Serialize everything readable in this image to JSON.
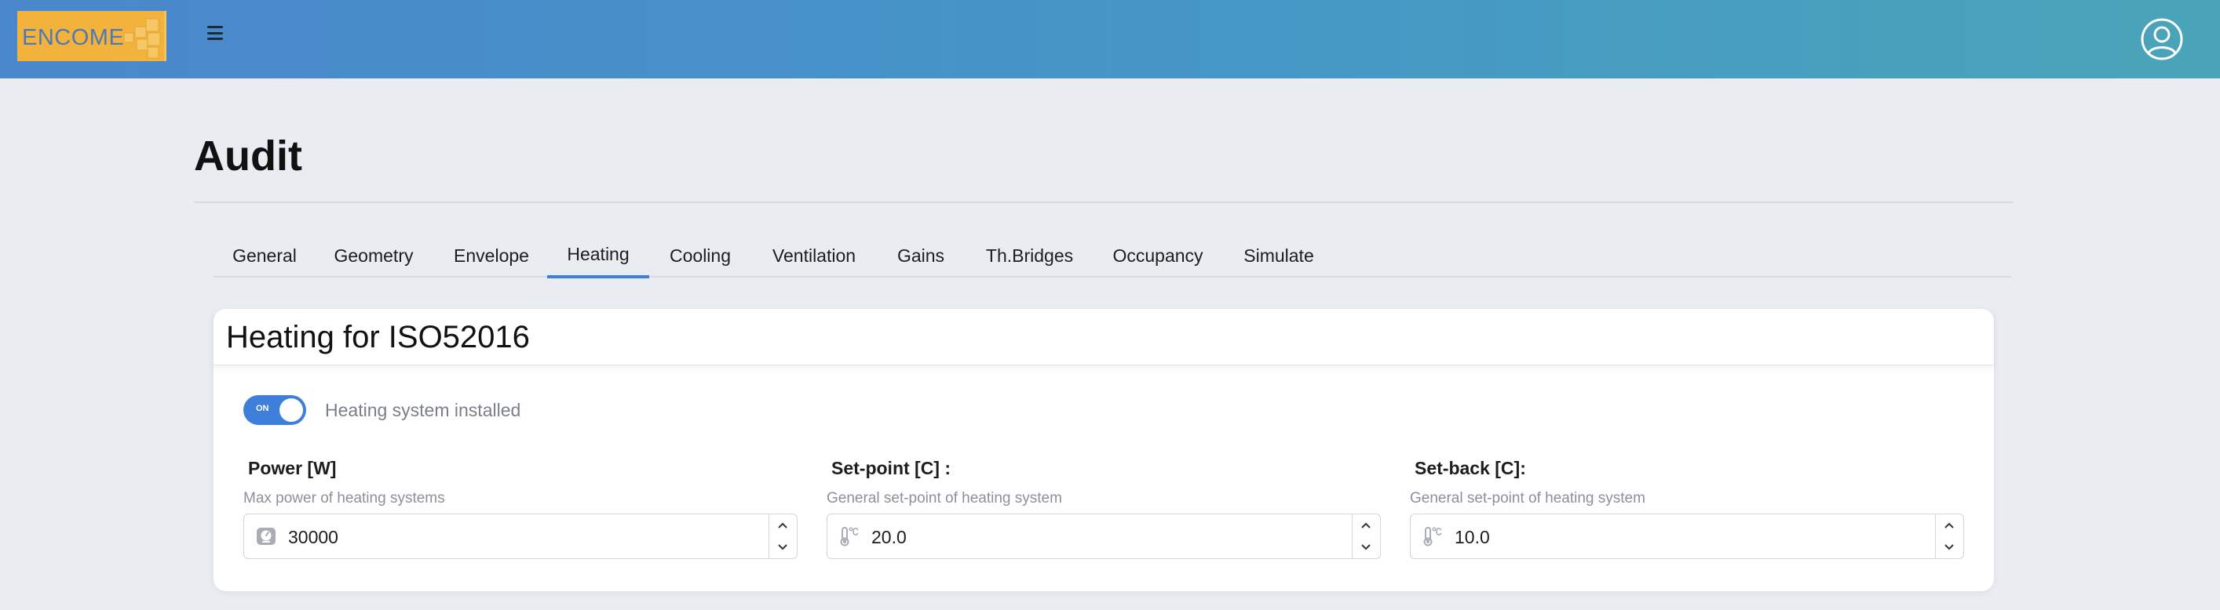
{
  "header": {
    "logo_text": "ENCOME",
    "menu_icon": "hamburger-icon",
    "user_icon": "user-circle-icon"
  },
  "page": {
    "title": "Audit"
  },
  "tabs": [
    {
      "label": "General"
    },
    {
      "label": "Geometry"
    },
    {
      "label": "Envelope"
    },
    {
      "label": "Heating",
      "active": true
    },
    {
      "label": "Cooling"
    },
    {
      "label": "Ventilation"
    },
    {
      "label": "Gains"
    },
    {
      "label": "Th.Bridges"
    },
    {
      "label": "Occupancy"
    },
    {
      "label": "Simulate"
    }
  ],
  "card": {
    "title": "Heating for ISO52016",
    "toggle": {
      "state_label": "ON",
      "label": "Heating system installed",
      "checked": true
    },
    "fields": [
      {
        "label": "Power [W]",
        "help": "Max power of heating systems",
        "value": "30000",
        "icon": "gauge-icon"
      },
      {
        "label": "Set-point [C] :",
        "help": "General set-point of heating system",
        "value": "20.0",
        "icon": "thermometer-celsius-icon"
      },
      {
        "label": "Set-back [C]:",
        "help": "General set-point of heating system",
        "value": "10.0",
        "icon": "thermometer-celsius-icon"
      }
    ]
  },
  "colors": {
    "header_start": "#4a87cc",
    "header_end": "#4aa4b8",
    "accent": "#3d7fd9",
    "logo_bg": "#f3b23c",
    "page_bg": "#e9ecf1"
  }
}
